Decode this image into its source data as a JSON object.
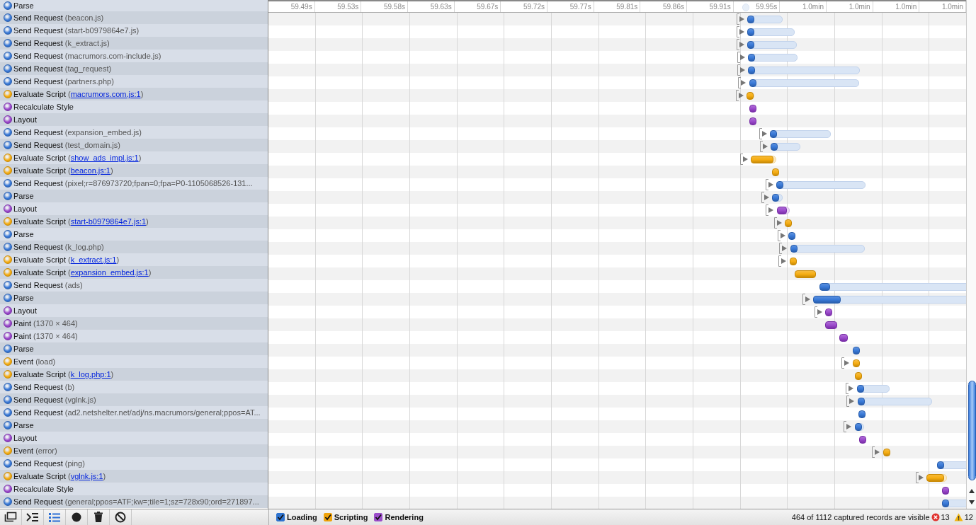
{
  "records": [
    {
      "kind": "loading",
      "label": "Parse"
    },
    {
      "kind": "loading",
      "label": "Send Request",
      "detail": "(beacon.js)"
    },
    {
      "kind": "loading",
      "label": "Send Request",
      "detail": "(start-b0979864e7.js)"
    },
    {
      "kind": "loading",
      "label": "Send Request",
      "detail": "(k_extract.js)"
    },
    {
      "kind": "loading",
      "label": "Send Request",
      "detail": "(macrumors.com-include.js)"
    },
    {
      "kind": "loading",
      "label": "Send Request",
      "detail": "(tag_request)"
    },
    {
      "kind": "loading",
      "label": "Send Request",
      "detail": "(partners.php)"
    },
    {
      "kind": "scripting",
      "label": "Evaluate Script",
      "before": "(",
      "link": "macrumors.com.js:1",
      "after": ")"
    },
    {
      "kind": "rendering",
      "label": "Recalculate Style"
    },
    {
      "kind": "rendering",
      "label": "Layout"
    },
    {
      "kind": "loading",
      "label": "Send Request",
      "detail": "(expansion_embed.js)"
    },
    {
      "kind": "loading",
      "label": "Send Request",
      "detail": "(test_domain.js)"
    },
    {
      "kind": "scripting",
      "label": "Evaluate Script",
      "before": "(",
      "link": "show_ads_impl.js:1",
      "after": ")"
    },
    {
      "kind": "scripting",
      "label": "Evaluate Script",
      "before": "(",
      "link": "beacon.js:1",
      "after": ")"
    },
    {
      "kind": "loading",
      "label": "Send Request",
      "detail": "(pixel;r=876973720;fpan=0;fpa=P0-1105068526-131..."
    },
    {
      "kind": "loading",
      "label": "Parse"
    },
    {
      "kind": "rendering",
      "label": "Layout"
    },
    {
      "kind": "scripting",
      "label": "Evaluate Script",
      "before": "(",
      "link": "start-b0979864e7.js:1",
      "after": ")"
    },
    {
      "kind": "loading",
      "label": "Parse"
    },
    {
      "kind": "loading",
      "label": "Send Request",
      "detail": "(k_log.php)"
    },
    {
      "kind": "scripting",
      "label": "Evaluate Script",
      "before": "(",
      "link": "k_extract.js:1",
      "after": ")"
    },
    {
      "kind": "scripting",
      "label": "Evaluate Script",
      "before": "(",
      "link": "expansion_embed.js:1",
      "after": ")"
    },
    {
      "kind": "loading",
      "label": "Send Request",
      "detail": "(ads)"
    },
    {
      "kind": "loading",
      "label": "Parse"
    },
    {
      "kind": "rendering",
      "label": "Layout"
    },
    {
      "kind": "rendering",
      "label": "Paint",
      "detail": "(1370 × 464)"
    },
    {
      "kind": "rendering",
      "label": "Paint",
      "detail": "(1370 × 464)"
    },
    {
      "kind": "loading",
      "label": "Parse"
    },
    {
      "kind": "scripting",
      "label": "Event",
      "detail": "(load)"
    },
    {
      "kind": "scripting",
      "label": "Evaluate Script",
      "before": "(",
      "link": "k_log.php:1",
      "after": ")"
    },
    {
      "kind": "loading",
      "label": "Send Request",
      "detail": "(b)"
    },
    {
      "kind": "loading",
      "label": "Send Request",
      "detail": "(vglnk.js)"
    },
    {
      "kind": "loading",
      "label": "Send Request",
      "detail": "(ad2.netshelter.net/adj/ns.macrumors/general;ppos=AT..."
    },
    {
      "kind": "loading",
      "label": "Parse"
    },
    {
      "kind": "rendering",
      "label": "Layout"
    },
    {
      "kind": "scripting",
      "label": "Event",
      "detail": "(error)"
    },
    {
      "kind": "loading",
      "label": "Send Request",
      "detail": "(ping)"
    },
    {
      "kind": "scripting",
      "label": "Evaluate Script",
      "before": "(",
      "link": "vglnk.js:1",
      "after": ")"
    },
    {
      "kind": "rendering",
      "label": "Recalculate Style"
    },
    {
      "kind": "loading",
      "label": "Send Request",
      "detail": "(general;ppos=ATF;kw=;tile=1;sz=728x90;ord=271897..."
    }
  ],
  "ticks": [
    "59.49s",
    "59.53s",
    "59.58s",
    "59.63s",
    "59.67s",
    "59.72s",
    "59.77s",
    "59.81s",
    "59.86s",
    "59.91s",
    "59.95s",
    "1.0min",
    "1.0min",
    "1.0min",
    "1.0min"
  ],
  "toolbar": [
    {
      "kind": "dock",
      "selected": false
    },
    {
      "kind": "console",
      "selected": false
    },
    {
      "kind": "list",
      "selected": true
    },
    {
      "kind": "record",
      "selected": false
    },
    {
      "kind": "trash",
      "selected": false
    },
    {
      "kind": "clear",
      "selected": false
    }
  ],
  "filters": [
    {
      "label": "Loading",
      "checked": true,
      "color": "#2f74d0"
    },
    {
      "label": "Scripting",
      "checked": true,
      "color": "#f0a30a"
    },
    {
      "label": "Rendering",
      "checked": true,
      "color": "#9b4dca"
    }
  ],
  "status": "464 of 1112 captured records are visible",
  "errors": "13",
  "warnings": "12"
}
